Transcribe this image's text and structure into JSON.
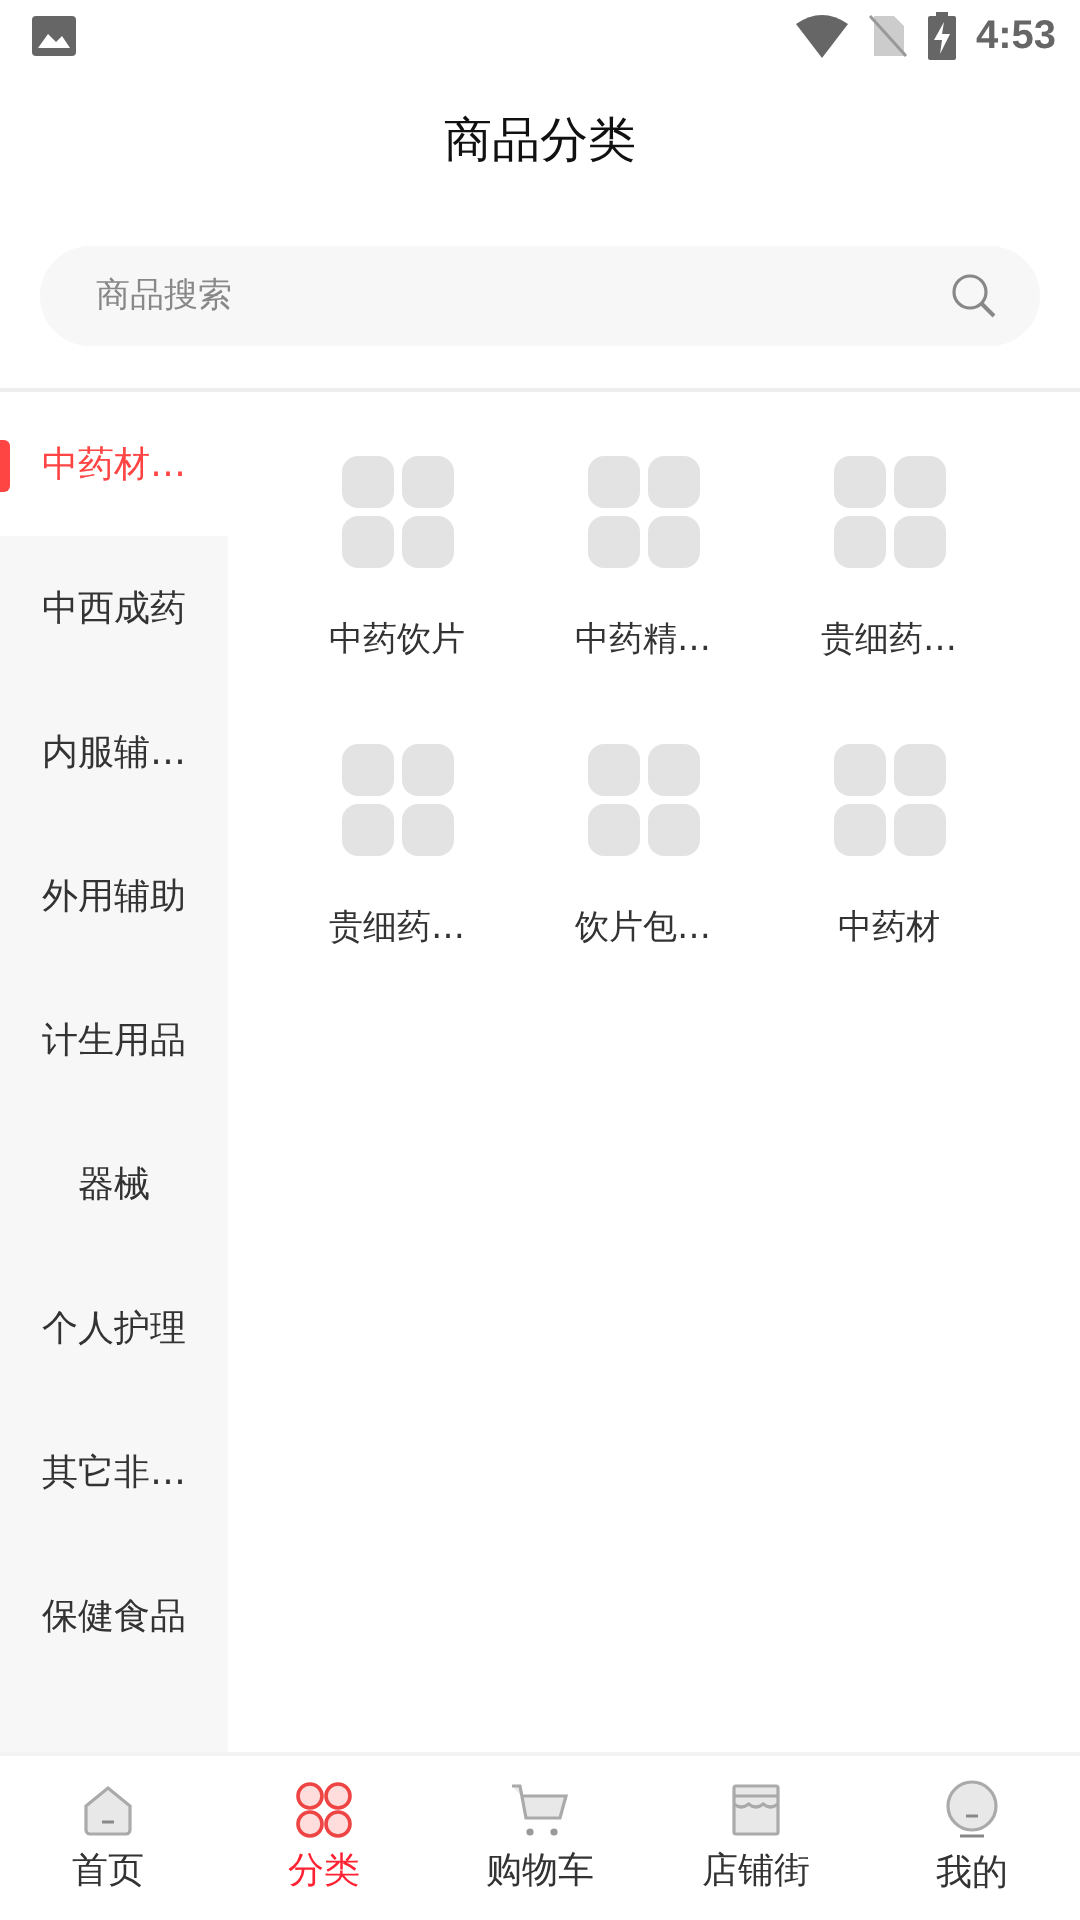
{
  "status_bar": {
    "time": "4:53"
  },
  "header": {
    "title": "商品分类"
  },
  "search": {
    "placeholder": "商品搜索"
  },
  "sidebar": {
    "items": [
      {
        "label": "中药材…",
        "selected": true
      },
      {
        "label": "中西成药",
        "selected": false
      },
      {
        "label": "内服辅…",
        "selected": false
      },
      {
        "label": "外用辅助",
        "selected": false
      },
      {
        "label": "计生用品",
        "selected": false
      },
      {
        "label": "器械",
        "selected": false
      },
      {
        "label": "个人护理",
        "selected": false
      },
      {
        "label": "其它非…",
        "selected": false
      },
      {
        "label": "保健食品",
        "selected": false
      }
    ]
  },
  "categories": [
    {
      "label": "中药饮片"
    },
    {
      "label": "中药精…"
    },
    {
      "label": "贵细药…"
    },
    {
      "label": "贵细药…"
    },
    {
      "label": "饮片包…"
    },
    {
      "label": "中药材"
    }
  ],
  "tab_bar": [
    {
      "kind": "home",
      "label": "首页",
      "selected": false
    },
    {
      "kind": "category",
      "label": "分类",
      "selected": true
    },
    {
      "kind": "cart",
      "label": "购物车",
      "selected": false
    },
    {
      "kind": "store",
      "label": "店铺街",
      "selected": false
    },
    {
      "kind": "profile",
      "label": "我的",
      "selected": false
    }
  ]
}
